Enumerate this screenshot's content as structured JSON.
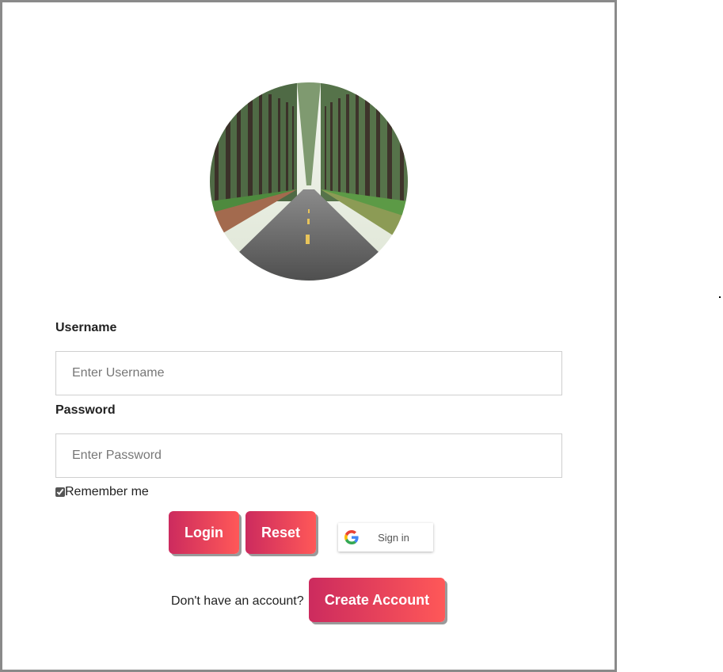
{
  "form": {
    "username_label": "Username",
    "username_placeholder": "Enter Username",
    "password_label": "Password",
    "password_placeholder": "Enter Password",
    "remember_label": "Remember me",
    "remember_checked": true
  },
  "actions": {
    "login_label": "Login",
    "reset_label": "Reset",
    "google_label": "Sign in"
  },
  "signup": {
    "prompt": "Don't have an account?",
    "button_label": "Create Account"
  },
  "colors": {
    "button_gradient_start": "#cc2b5e",
    "button_gradient_end": "#ff5858",
    "card_border": "#8a8a8a"
  },
  "icons": {
    "google": "google-g-icon"
  }
}
